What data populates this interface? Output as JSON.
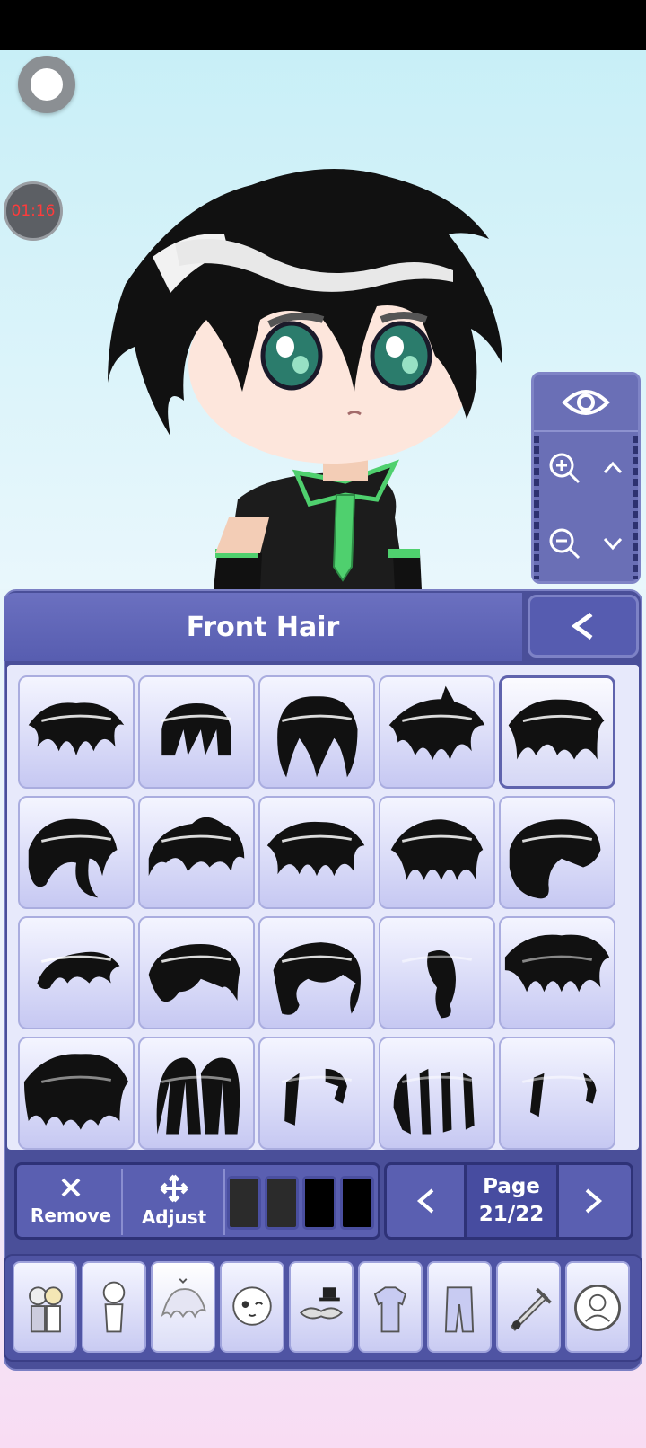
{
  "timer": "01:16",
  "panel": {
    "title": "Front Hair"
  },
  "tools": {
    "remove_label": "Remove",
    "adjust_label": "Adjust"
  },
  "pager": {
    "page_word": "Page",
    "page_value": "21/22"
  },
  "colors": {
    "panel": "#4a4f99",
    "header": "#6b70c0",
    "hair": "#111111",
    "cell": "#d3d5f6"
  },
  "swatches": [
    "#2b2b2b",
    "#2b2b2b",
    "#000000",
    "#000000"
  ],
  "hair_items": [
    {
      "icon": "front-hair-style-1"
    },
    {
      "icon": "front-hair-style-2"
    },
    {
      "icon": "front-hair-style-3"
    },
    {
      "icon": "front-hair-style-4"
    },
    {
      "icon": "front-hair-style-5",
      "selected": true
    },
    {
      "icon": "front-hair-style-6"
    },
    {
      "icon": "front-hair-style-7"
    },
    {
      "icon": "front-hair-style-8"
    },
    {
      "icon": "front-hair-style-9"
    },
    {
      "icon": "front-hair-style-10"
    },
    {
      "icon": "front-hair-style-11"
    },
    {
      "icon": "front-hair-style-12"
    },
    {
      "icon": "front-hair-style-13"
    },
    {
      "icon": "front-hair-style-14"
    },
    {
      "icon": "front-hair-style-15"
    },
    {
      "icon": "front-hair-style-16"
    },
    {
      "icon": "front-hair-style-17"
    },
    {
      "icon": "front-hair-style-18"
    },
    {
      "icon": "front-hair-style-19"
    },
    {
      "icon": "front-hair-style-20"
    }
  ],
  "categories": [
    {
      "icon": "characters-icon"
    },
    {
      "icon": "body-icon"
    },
    {
      "icon": "hair-icon",
      "active": true
    },
    {
      "icon": "face-icon"
    },
    {
      "icon": "accessories-icon"
    },
    {
      "icon": "top-icon"
    },
    {
      "icon": "bottom-icon"
    },
    {
      "icon": "weapon-icon"
    },
    {
      "icon": "profile-icon"
    }
  ]
}
